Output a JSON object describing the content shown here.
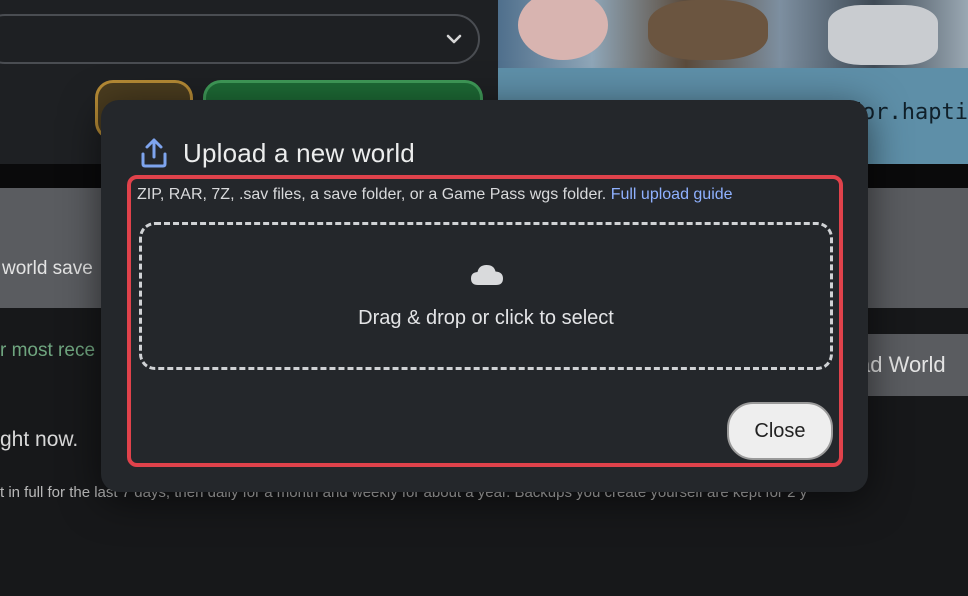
{
  "background": {
    "code_text": "dor.hapti",
    "grey_text": "world save",
    "green_text": "r most rece",
    "upload_button_label": "ad World",
    "status_text": "ght now.",
    "retention_text": "t in full for the last 7 days, then daily for a month and weekly for about a year. Backups you create yourself are kept for 2 y"
  },
  "modal": {
    "title": "Upload a new world",
    "title_icon": "upload-icon",
    "description": "ZIP, RAR, 7Z, .sav files, a save folder, or a Game Pass wgs folder.",
    "guide_link": "Full upload guide",
    "dropzone": {
      "icon": "cloud-icon",
      "label": "Drag & drop or click to select"
    },
    "close_label": "Close"
  },
  "colors": {
    "modal_bg": "#24272b",
    "highlight": "#e0424b",
    "link": "#8fb1ff",
    "icon_accent": "#7ea4ee"
  }
}
